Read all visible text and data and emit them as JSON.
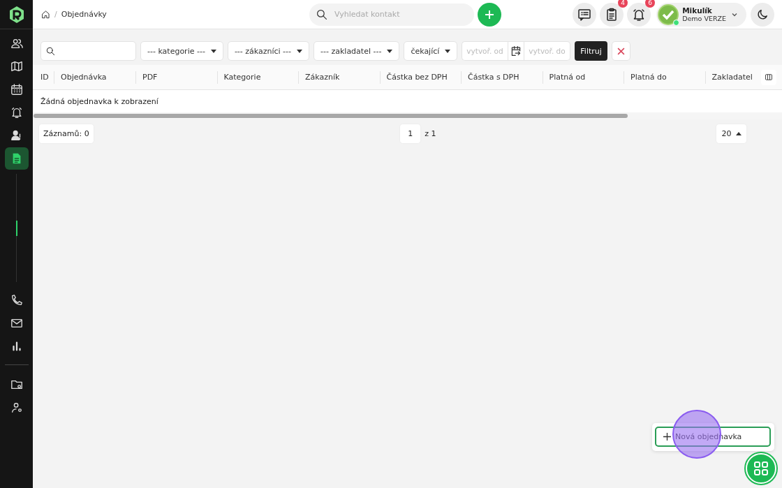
{
  "sidebar": {
    "items": [
      {
        "kind": "people",
        "selected": false
      },
      {
        "kind": "map",
        "selected": false
      },
      {
        "kind": "calendar",
        "selected": false
      },
      {
        "kind": "bell",
        "selected": false
      },
      {
        "kind": "person",
        "selected": false
      },
      {
        "kind": "document",
        "selected": true
      }
    ],
    "bottom_items": [
      {
        "kind": "phone",
        "selected": false
      },
      {
        "kind": "mail",
        "selected": false
      },
      {
        "kind": "chart",
        "selected": false
      }
    ],
    "settings_items": [
      {
        "kind": "folder-gear"
      },
      {
        "kind": "user-gear"
      }
    ]
  },
  "breadcrumb": {
    "separator": "/",
    "current": "Objednávky"
  },
  "search": {
    "placeholder": "Vyhledat kontakt"
  },
  "toolbar": [
    {
      "kind": "chat"
    },
    {
      "kind": "clipboard",
      "badge": "4"
    },
    {
      "kind": "bell",
      "badge": "6"
    }
  ],
  "user": {
    "name": "Mikulík",
    "subtitle": "Demo VERZE",
    "online": true
  },
  "filters": {
    "selects": [
      "--- kategorie ---",
      "--- zákazníci ---",
      "--- zakladatel ---",
      "čekající"
    ],
    "date_from": {
      "placeholder": "vytvoř. od"
    },
    "date_to": {
      "placeholder": "vytvoř. do"
    },
    "apply": "Filtruj"
  },
  "table": {
    "columns": [
      "ID",
      "Objednávka",
      "PDF",
      "Kategorie",
      "Zákazník",
      "Částka bez DPH",
      "Částka s DPH",
      "Platná od",
      "Platná do",
      "Zakladatel"
    ],
    "empty_message": "Žádná objednavka k zobrazení"
  },
  "footer": {
    "records": "Záznamů: 0",
    "page": "1",
    "page_total": "z 1",
    "page_size": "20"
  },
  "fab_menu": {
    "items": [
      "Nová objednavka"
    ]
  },
  "click_indicator": true
}
